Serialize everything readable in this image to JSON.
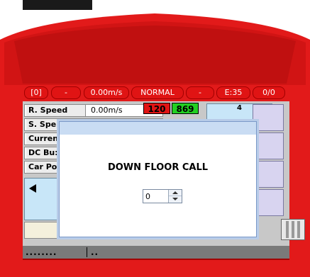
{
  "colors": {
    "housing_red": "#e21a1a",
    "housing_dark_red": "#b50d0d",
    "speed_red": "#e01414",
    "speed_green": "#22d022",
    "floor_blue": "#c8e6f8",
    "grid_lavender": "#d8d4f0"
  },
  "status_bar": {
    "items": [
      "[0]",
      "-",
      "0.00m/s",
      "NORMAL",
      "-",
      "E:35",
      "0/0"
    ]
  },
  "info_rows": [
    {
      "label": "R. Speed",
      "value": "0.00m/s"
    },
    {
      "label": "S. Spe",
      "value": ""
    },
    {
      "label": "Curren",
      "value": ""
    },
    {
      "label": "DC Bu:",
      "value": ""
    },
    {
      "label": "Car Po",
      "value": ""
    }
  ],
  "speed_numbers": {
    "red_value": "120",
    "green_value": "869"
  },
  "floor_display": {
    "value": "4"
  },
  "icons": [
    "left-arrow-icon",
    "door-icon",
    "spin-up-icon",
    "spin-down-icon"
  ],
  "dots_bar": {
    "left": "........",
    "right": ".."
  },
  "dialog": {
    "message": "DOWN FLOOR CALL",
    "spinner_value": "0"
  }
}
